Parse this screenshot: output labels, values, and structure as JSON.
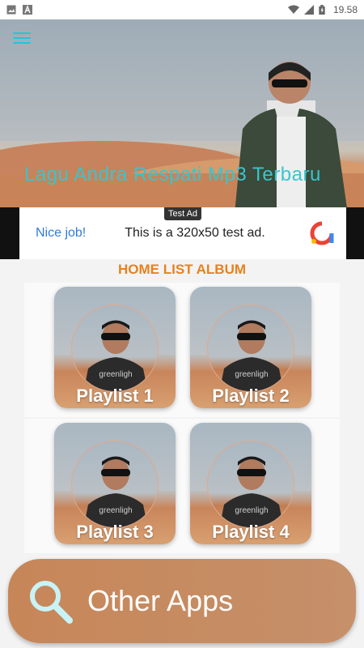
{
  "status_bar": {
    "time": "19.58",
    "icons": [
      "image-icon",
      "a-icon",
      "wifi-icon",
      "signal-icon",
      "battery-icon"
    ]
  },
  "hero": {
    "title": "Lagu Andra Respati Mp3 Terbaru",
    "menu_icon": "hamburger-icon",
    "title_color": "#38c5cf"
  },
  "ad": {
    "badge": "Test Ad",
    "nice": "Nice job!",
    "text": "This is a 320x50 test ad."
  },
  "section": {
    "title": "HOME LIST ALBUM",
    "color": "#e8811d"
  },
  "playlists": [
    {
      "label": "Playlist 1"
    },
    {
      "label": "Playlist 2"
    },
    {
      "label": "Playlist 3"
    },
    {
      "label": "Playlist 4"
    }
  ],
  "other_apps": {
    "label": "Other Apps",
    "icon": "search-icon"
  }
}
